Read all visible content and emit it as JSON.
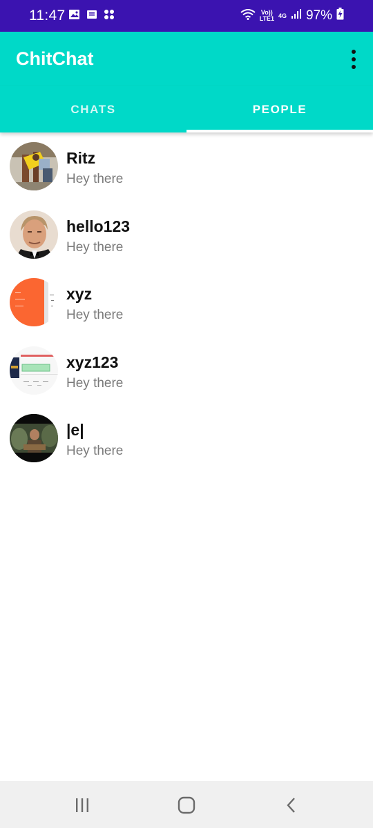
{
  "status_bar": {
    "time": "11:47",
    "volte": "Vo))",
    "lte": "LTE1",
    "network": "4G",
    "battery": "97%"
  },
  "app_bar": {
    "title": "ChitChat"
  },
  "tabs": [
    {
      "label": "CHATS",
      "selected": false
    },
    {
      "label": "PEOPLE",
      "selected": true
    }
  ],
  "people": [
    {
      "name": "Ritz",
      "status": "Hey there"
    },
    {
      "name": "hello123",
      "status": "Hey there"
    },
    {
      "name": "xyz",
      "status": "Hey there"
    },
    {
      "name": "xyz123",
      "status": "Hey there"
    },
    {
      "name": "|e|",
      "status": "Hey there"
    }
  ],
  "colors": {
    "status_bar": "#3b13b0",
    "accent": "#00d9c8",
    "name_text": "#111111",
    "status_text": "#7a7a7a"
  },
  "icons": {
    "status_left": [
      "gallery-icon",
      "message-icon",
      "apps-icon"
    ],
    "status_right": [
      "wifi-icon",
      "signal-icon",
      "battery-charging-icon"
    ],
    "app_bar": [
      "more-vert-icon"
    ],
    "nav": [
      "recents-icon",
      "home-icon",
      "back-icon"
    ]
  }
}
